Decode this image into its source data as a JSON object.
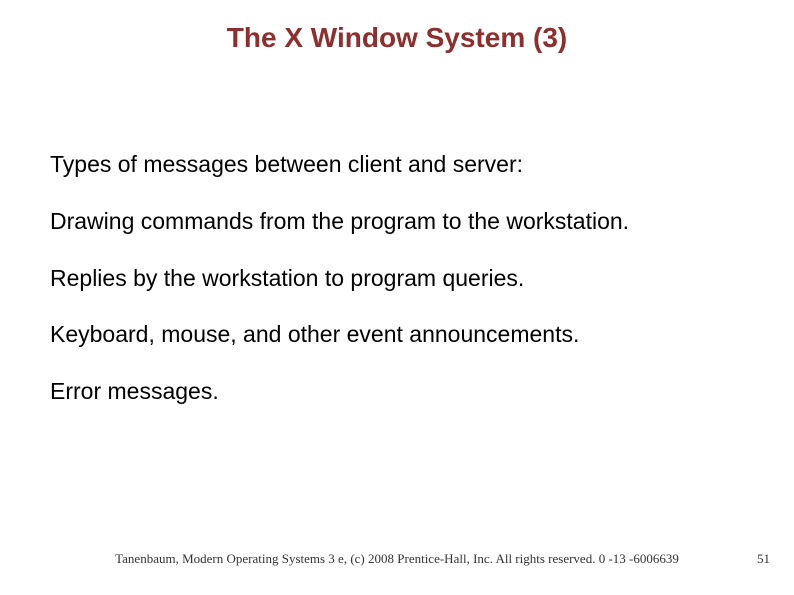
{
  "title": "The X Window System (3)",
  "body": {
    "intro": "Types of messages between client and server:",
    "items": [
      "Drawing commands from the program to the workstation.",
      "Replies by the workstation to program queries.",
      "Keyboard, mouse, and other event announcements.",
      "Error messages."
    ]
  },
  "footer": "Tanenbaum, Modern Operating Systems 3 e, (c) 2008 Prentice-Hall, Inc. All rights reserved. 0 -13 -6006639",
  "page_number": "51"
}
